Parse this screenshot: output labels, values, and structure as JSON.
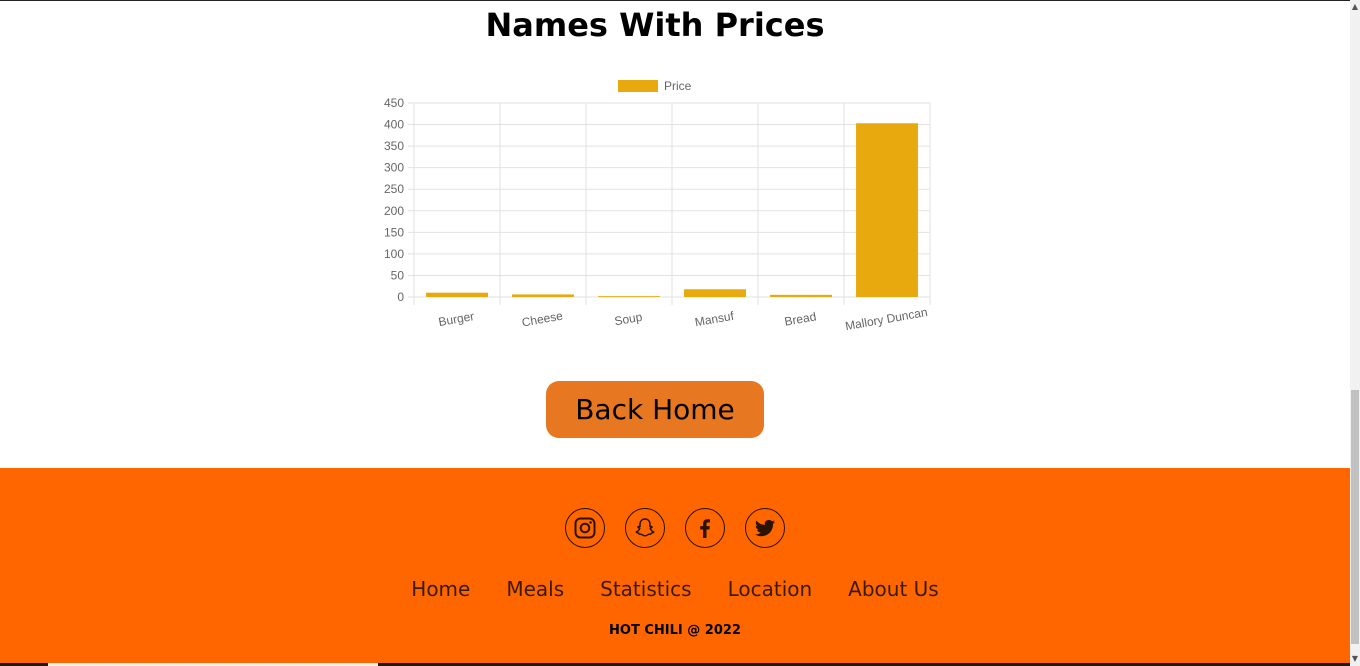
{
  "page": {
    "title": "Names With Prices"
  },
  "chart_data": {
    "type": "bar",
    "legend": "Price",
    "legend_position": "top",
    "color": "#e8a90e",
    "categories": [
      "Burger",
      "Cheese",
      "Soup",
      "Mansuf",
      "Bread",
      "Mallory Duncan"
    ],
    "values": [
      10,
      6,
      2,
      18,
      5,
      403
    ],
    "ylim": [
      0,
      450
    ],
    "y_ticks": [
      "450",
      "400",
      "350",
      "300",
      "250",
      "200",
      "150",
      "100",
      "50",
      "0"
    ],
    "grid": true
  },
  "back_button": {
    "label": "Back Home",
    "color": "#e87722"
  },
  "footer": {
    "background": "#ff6600",
    "social": [
      "instagram-icon",
      "snapchat-icon",
      "facebook-icon",
      "twitter-icon"
    ],
    "nav": [
      "Home",
      "Meals",
      "Statistics",
      "Location",
      "About Us"
    ],
    "copyright": "HOT CHILI @ 2022"
  }
}
